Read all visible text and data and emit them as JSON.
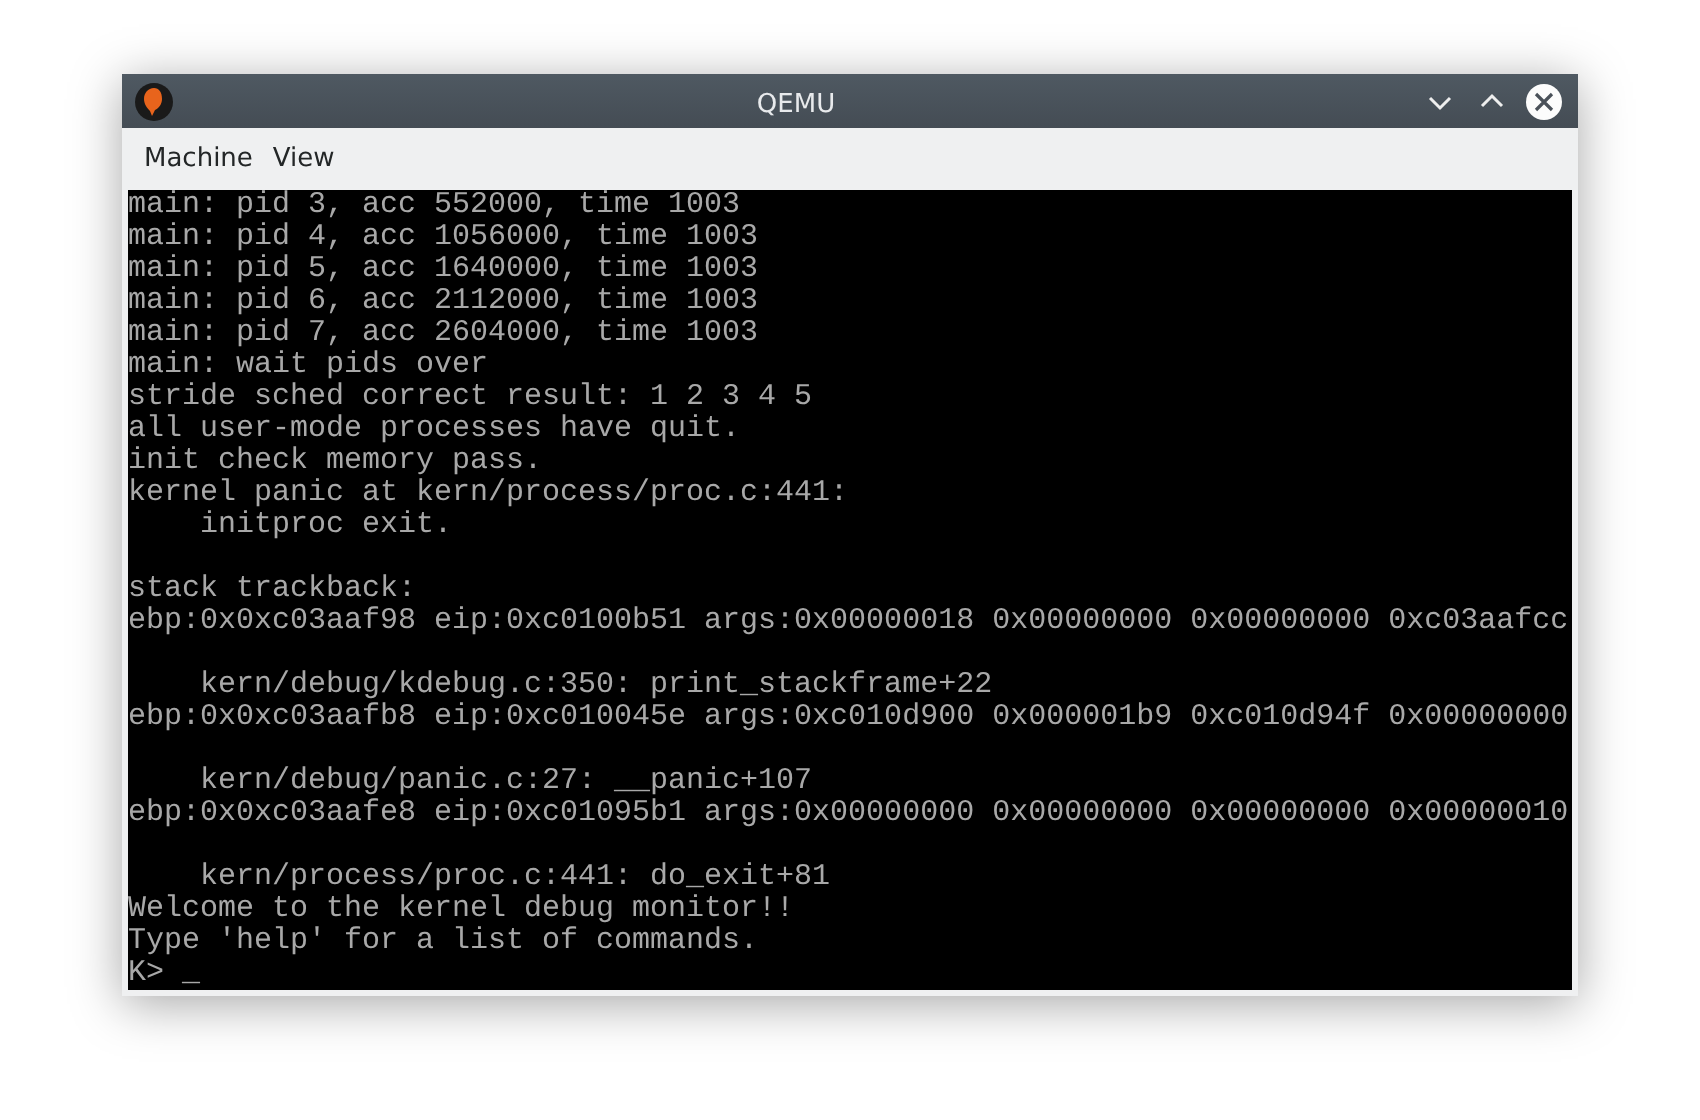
{
  "window": {
    "title": "QEMU"
  },
  "menu": [
    {
      "label": "Machine"
    },
    {
      "label": "View"
    }
  ],
  "console": {
    "lines": [
      {
        "kind": "text",
        "text": "main: pid 3, acc 552000, time 1003"
      },
      {
        "kind": "text",
        "text": "main: pid 4, acc 1056000, time 1003"
      },
      {
        "kind": "text",
        "text": "main: pid 5, acc 1640000, time 1003"
      },
      {
        "kind": "text",
        "text": "main: pid 6, acc 2112000, time 1003"
      },
      {
        "kind": "text",
        "text": "main: pid 7, acc 2604000, time 1003"
      },
      {
        "kind": "text",
        "text": "main: wait pids over"
      },
      {
        "kind": "text",
        "text": "stride sched correct result: 1 2 3 4 5"
      },
      {
        "kind": "text",
        "text": "all user-mode processes have quit."
      },
      {
        "kind": "text",
        "text": "init check memory pass."
      },
      {
        "kind": "text",
        "text": "kernel panic at kern/process/proc.c:441:"
      },
      {
        "kind": "text",
        "text": "    initproc exit."
      },
      {
        "kind": "blank"
      },
      {
        "kind": "text",
        "text": "stack trackback:"
      },
      {
        "kind": "text",
        "text": "ebp:0x0xc03aaf98 eip:0xc0100b51 args:0x00000018 0x00000000 0x00000000 0xc03aafcc"
      },
      {
        "kind": "blank"
      },
      {
        "kind": "text",
        "text": "    kern/debug/kdebug.c:350: print_stackframe+22"
      },
      {
        "kind": "text",
        "text": "ebp:0x0xc03aafb8 eip:0xc010045e args:0xc010d900 0x000001b9 0xc010d94f 0x00000000"
      },
      {
        "kind": "blank"
      },
      {
        "kind": "text",
        "text": "    kern/debug/panic.c:27: __panic+107"
      },
      {
        "kind": "text",
        "text": "ebp:0x0xc03aafe8 eip:0xc01095b1 args:0x00000000 0x00000000 0x00000000 0x00000010"
      },
      {
        "kind": "blank"
      },
      {
        "kind": "text",
        "text": "    kern/process/proc.c:441: do_exit+81"
      },
      {
        "kind": "text",
        "text": "Welcome to the kernel debug monitor!!"
      },
      {
        "kind": "text",
        "text": "Type 'help' for a list of commands."
      }
    ],
    "prompt": {
      "text": "K>",
      "cursor": "_"
    }
  }
}
